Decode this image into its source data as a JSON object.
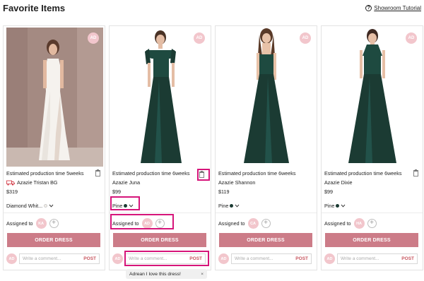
{
  "page": {
    "title": "Favorite Items",
    "tutorial_label": "Showroom Tutorial"
  },
  "icons": {
    "badge": "ad-badge-icon",
    "trash": "trash-icon",
    "truck": "delivery-truck-icon",
    "chevron": "chevron-down-icon",
    "help": "help-icon",
    "plus": "plus-icon"
  },
  "colors": {
    "accent": "#cc7c88",
    "highlight": "#d6157a",
    "avatar": "#f2c6cc",
    "dress_green": "#1b3b33",
    "post": "#c7565f"
  },
  "labels": {
    "badge": "AD",
    "order_button": "ORDER DRESS",
    "assigned_to": "Assigned to",
    "comment_placeholder": "Write a comment...",
    "post": "POST"
  },
  "items": [
    {
      "estimate": "Estimated production time 5weeks",
      "name": "Azazie Tristan BG",
      "price": "$319",
      "color": "Diamond Whit...",
      "assigned_initials": "KA",
      "commenter_initials": "AD"
    },
    {
      "estimate": "Estimated production time 6weeks",
      "name": "Azazie Juna",
      "price": "$99",
      "color": "Pine",
      "assigned_initials": "AD",
      "commenter_initials": "AD"
    },
    {
      "estimate": "Estimated production time 6weeks",
      "name": "Azazie Shannon",
      "price": "$119",
      "color": "Pine",
      "assigned_initials": "CA",
      "commenter_initials": "AD"
    },
    {
      "estimate": "Estimated production time 6weeks",
      "name": "Azazie Dixie",
      "price": "$99",
      "color": "Pine",
      "assigned_initials": "HA",
      "commenter_initials": "AD"
    }
  ],
  "comment_chip": {
    "text": "Adrean I love this dress!",
    "close": "×"
  }
}
